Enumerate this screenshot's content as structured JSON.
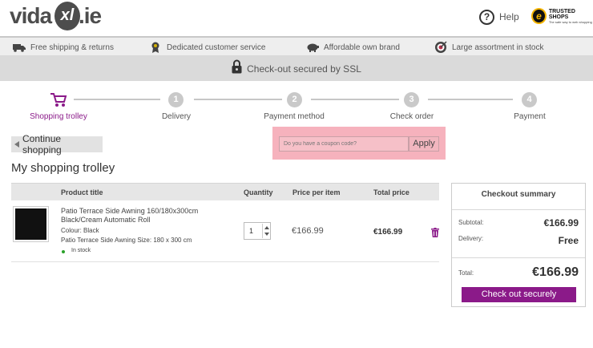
{
  "header": {
    "logo": {
      "part1": "vida",
      "mark": "xl",
      "part2": ".ie"
    },
    "help_label": "Help",
    "trusted_shops": {
      "title": "TRUSTED SHOPS",
      "subtitle": "The safe way to web shopping"
    }
  },
  "usp_bar": [
    {
      "label": "Free shipping & returns",
      "icon": "truck-icon"
    },
    {
      "label": "Dedicated customer service",
      "icon": "award-ribbon-icon"
    },
    {
      "label": "Affordable own brand",
      "icon": "piggy-bank-icon"
    },
    {
      "label": "Large assortment in stock",
      "icon": "target-icon"
    }
  ],
  "ssl_bar": {
    "label": "Check-out secured by SSL",
    "icon": "lock-icon"
  },
  "steps": [
    {
      "label": "Shopping trolley",
      "number": "",
      "active": true
    },
    {
      "label": "Delivery",
      "number": "1",
      "active": false
    },
    {
      "label": "Payment method",
      "number": "2",
      "active": false
    },
    {
      "label": "Check order",
      "number": "3",
      "active": false
    },
    {
      "label": "Payment",
      "number": "4",
      "active": false
    }
  ],
  "continue_label": "Continue shopping",
  "coupon": {
    "placeholder": "Do you have a coupon code?",
    "apply_label": "Apply"
  },
  "page_title": "My shopping trolley",
  "table": {
    "headers": {
      "product": "Product title",
      "quantity": "Quantity",
      "price": "Price per item",
      "total": "Total price"
    },
    "rows": [
      {
        "title": "Patio Terrace Side Awning 160/180x300cm Black/Cream Automatic Roll",
        "colour": "Colour: Black",
        "size": "Patio Terrace Side Awning Size: 180 x 300 cm",
        "stock": "In stock",
        "quantity": "1",
        "price": "€166.99",
        "total": "€166.99"
      }
    ]
  },
  "summary": {
    "title": "Checkout summary",
    "subtotal_label": "Subtotal:",
    "subtotal_value": "€166.99",
    "delivery_label": "Delivery:",
    "delivery_value": "Free",
    "total_label": "Total:",
    "total_value": "€166.99",
    "checkout_label": "Check out securely"
  },
  "colors": {
    "brand": "#8b1a89",
    "coupon_highlight": "#f6b2bd",
    "in_stock": "#2aa12a"
  }
}
